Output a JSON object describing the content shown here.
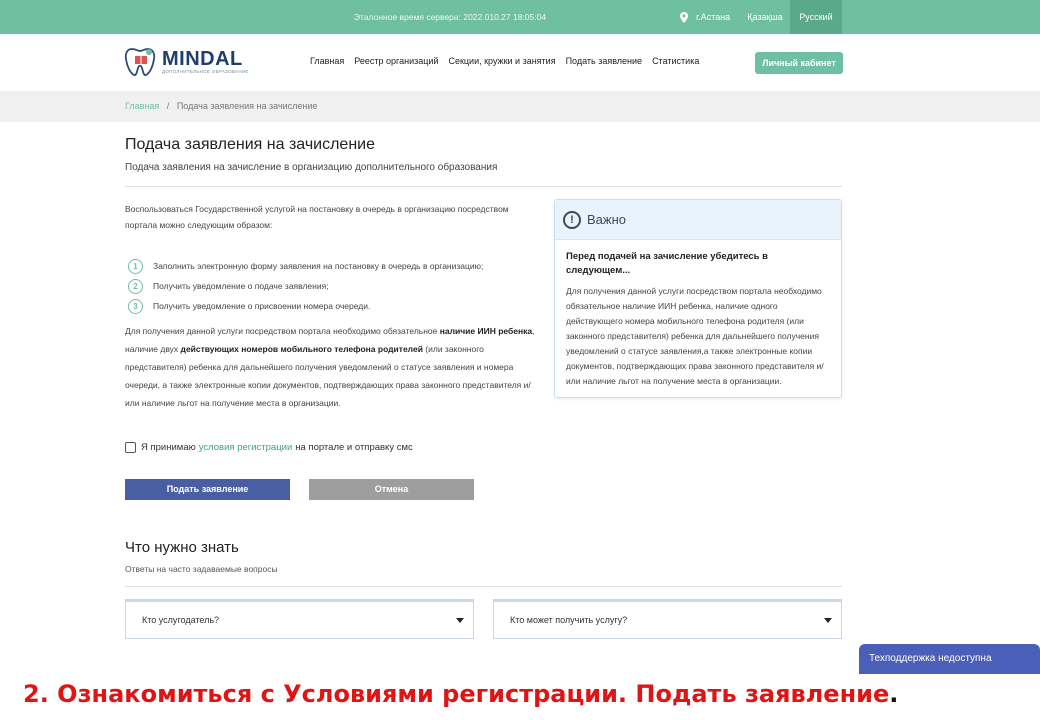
{
  "topbar": {
    "server_time": "Эталонное время сервера: 2022.010.27 18:05:04",
    "city": "г.Астана",
    "lang_kz": "Қазақша",
    "lang_ru": "Русский"
  },
  "header": {
    "logo_word": "MINDAL",
    "logo_sub": "ДОПОЛНИТЕЛЬНОЕ ОБРАЗОВАНИЕ",
    "nav": [
      "Главная",
      "Реестр организаций",
      "Секции, кружки и занятия",
      "Подать заявление",
      "Статистика"
    ],
    "cabinet": "Личный кабинет"
  },
  "breadcrumb": {
    "home": "Главная",
    "sep": "/",
    "current": "Подача заявления на зачисление"
  },
  "page": {
    "title": "Подача заявления на зачисление",
    "subtitle": "Подача заявления на зачисление в организацию дополнительного образования",
    "intro": "Воспользоваться Государственной услугой на постановку в очередь в организацию посредством портала можно следующим образом:",
    "steps": [
      {
        "num": "1",
        "text": "Заполнить электронную форму заявления на постановку в очередь в организацию;"
      },
      {
        "num": "2",
        "text": "Получить уведомление о подаче заявления;"
      },
      {
        "num": "3",
        "text": "Получить уведомление о присвоении номера очереди."
      }
    ],
    "details": {
      "p1": "Для получения данной услуги посредством портала необходимо обязательное ",
      "b1": "наличие ИИН ребенка",
      "p2": ", наличие двух ",
      "b2": "действующих номеров мобильного телефона родителей",
      "p3": " (или законного представителя) ребенка для дальнейшего получения уведомлений о статусе заявления и номера очереди, а также электронные копии документов, подтверждающих права законного представителя и/или наличие льгот на получение места в организации."
    }
  },
  "infobox": {
    "icon": "exclamation-circle-icon",
    "heading": "Важно",
    "bold": "Перед подачей на зачисление убедитесь в следующем...",
    "text": "Для получения данной услуги посредством портала необходимо обязательное наличие ИИН ребенка, наличие одного действующего номера мобильного телефона родителя (или законного представителя) ребенка для дальнейшего получения уведомлений о статусе заявления,а также электронные копии документов, подтверждающих права законного представителя и/или наличие льгот на получение места в организации."
  },
  "agree": {
    "before": "Я принимаю",
    "link": "условия регистрации",
    "after": "на портале и отправку смс"
  },
  "buttons": {
    "submit": "Подать заявление",
    "cancel": "Отмена"
  },
  "faq": {
    "title": "Что нужно знать",
    "subtitle": "Ответы на часто задаваемые вопросы",
    "items": [
      "Кто услугодатель?",
      "Кто может получить услугу?"
    ]
  },
  "support": "Техподдержка недоступна",
  "caption": {
    "text": "2. Ознакомиться с Условиями регистрации. Подать заявление",
    "dot": "."
  },
  "colors": {
    "brand_green": "#6fbfa3",
    "submit_blue": "#4a5fa3",
    "caption_red": "#e01414"
  }
}
